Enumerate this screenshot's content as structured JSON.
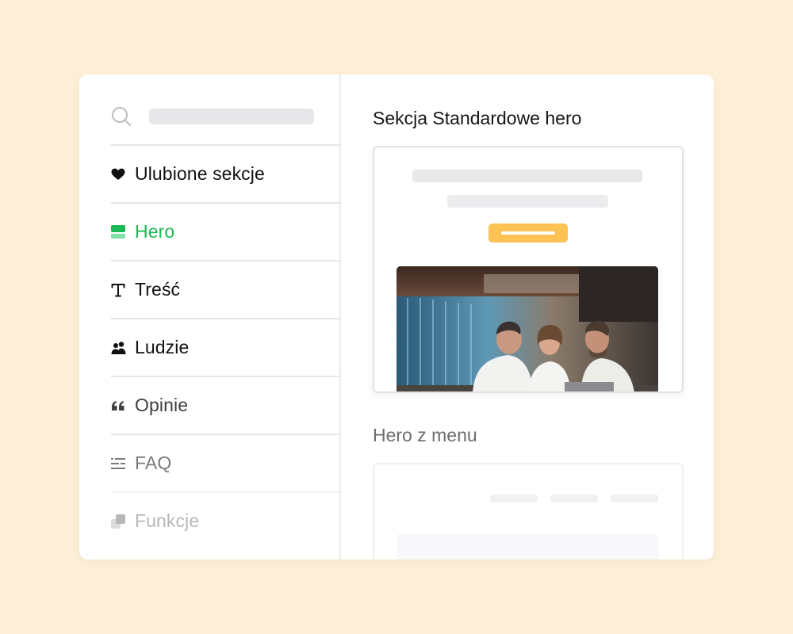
{
  "sidebar": {
    "search": {
      "placeholder": ""
    },
    "items": [
      {
        "label": "Ulubione sekcje",
        "icon": "heart-icon",
        "state": "normal"
      },
      {
        "label": "Hero",
        "icon": "hero-layout-icon",
        "state": "active"
      },
      {
        "label": "Treść",
        "icon": "text-icon",
        "state": "normal"
      },
      {
        "label": "Ludzie",
        "icon": "people-icon",
        "state": "normal"
      },
      {
        "label": "Opinie",
        "icon": "quote-icon",
        "state": "normal"
      },
      {
        "label": "FAQ",
        "icon": "list-icon",
        "state": "normal"
      },
      {
        "label": "Funkcje",
        "icon": "features-icon",
        "state": "normal"
      }
    ]
  },
  "main": {
    "sections": [
      {
        "title": "Sekcja Standardowe hero",
        "preview": "standard-hero"
      },
      {
        "title": "Hero z menu",
        "preview": "hero-with-menu"
      }
    ]
  },
  "colors": {
    "background": "#fdefd7",
    "accent_green": "#1db954",
    "button_yellow": "#fdc254",
    "placeholder_gray": "#e7e7ea"
  }
}
